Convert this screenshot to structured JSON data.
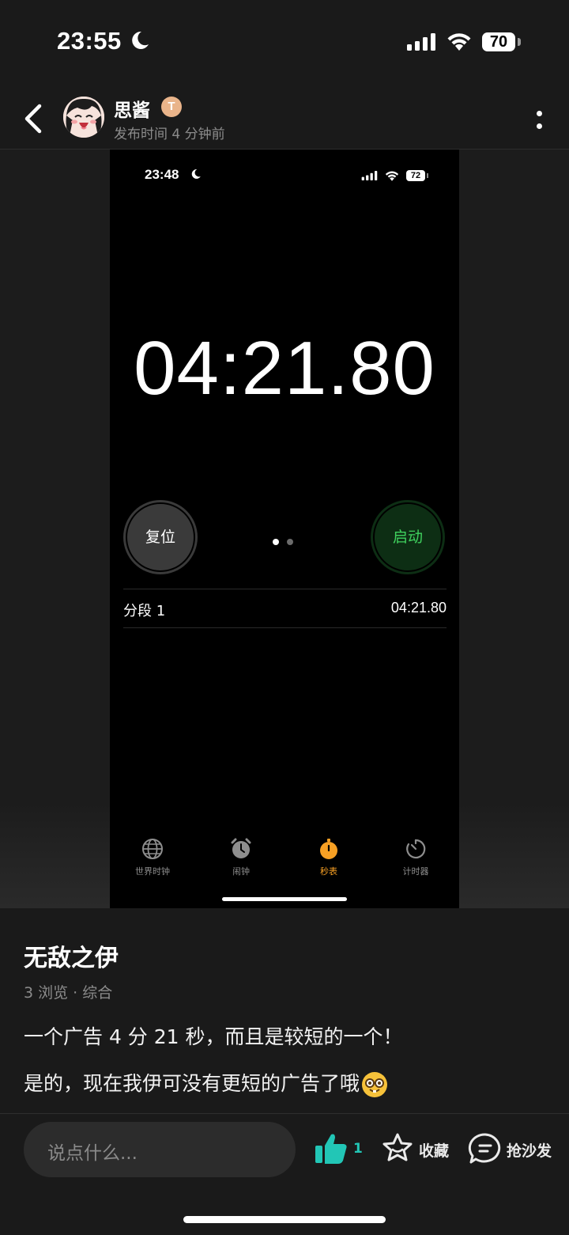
{
  "status_bar": {
    "time": "23:55",
    "battery": "70"
  },
  "header": {
    "username": "思酱",
    "badge": "T",
    "publish_time": "发布时间 4 分钟前"
  },
  "screenshot": {
    "status_time": "23:48",
    "battery": "72",
    "stopwatch": "04:21.80",
    "reset_label": "复位",
    "start_label": "启动",
    "lap_label": "分段 1",
    "lap_time": "04:21.80",
    "tabs": [
      {
        "label": "世界时钟",
        "icon": "globe-icon"
      },
      {
        "label": "闹钟",
        "icon": "alarm-icon"
      },
      {
        "label": "秒表",
        "icon": "stopwatch-icon",
        "active": true
      },
      {
        "label": "计时器",
        "icon": "timer-icon"
      }
    ],
    "accent_color": "#f7a024",
    "start_color": "#3fd15e"
  },
  "post": {
    "title": "无敌之伊",
    "meta": "3 浏览 · 综合",
    "line1": "一个广告 4 分 21 秒，而且是较短的一个！",
    "line2": "是的，现在我伊可没有更短的广告了哦"
  },
  "bottom_bar": {
    "comment_placeholder": "说点什么...",
    "like_count": "1",
    "favorite_label": "收藏",
    "sofa_label": "抢沙发",
    "like_color": "#22c6b6"
  }
}
